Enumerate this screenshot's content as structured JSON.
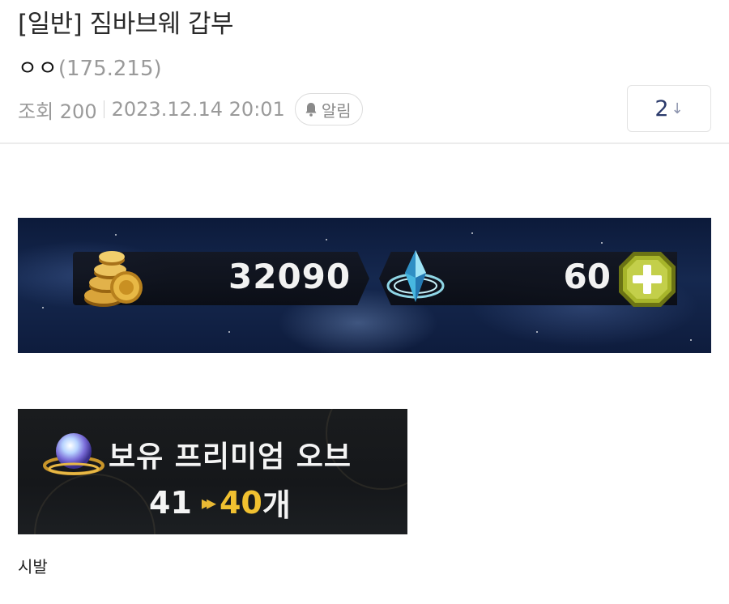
{
  "post": {
    "title": "[일반] 짐바브웨 갑부",
    "author_nick": "ㅇㅇ",
    "author_ip": "(175.215)",
    "views": "조회 200",
    "date": "2023.12.14 20:01",
    "alarm_label": "알림",
    "comment_count": "2",
    "comment_arrow": "↓",
    "body_text": "시발"
  },
  "game_currency": {
    "gold": "32090",
    "gems": "60",
    "add_icon": "plus-icon",
    "gold_icon": "gold-coins-icon",
    "gem_icon": "crystal-icon"
  },
  "premium_orb": {
    "label": "보유 프리미엄 오브",
    "before": "41",
    "arrow": "▸▸",
    "after": "40",
    "unit": "개",
    "icon": "orb-icon"
  },
  "colors": {
    "ip_gray": "#9a9a9a",
    "comment_count": "#2b3a6b",
    "orb_after": "#f0c030",
    "plus_green": "#a7b52a"
  }
}
